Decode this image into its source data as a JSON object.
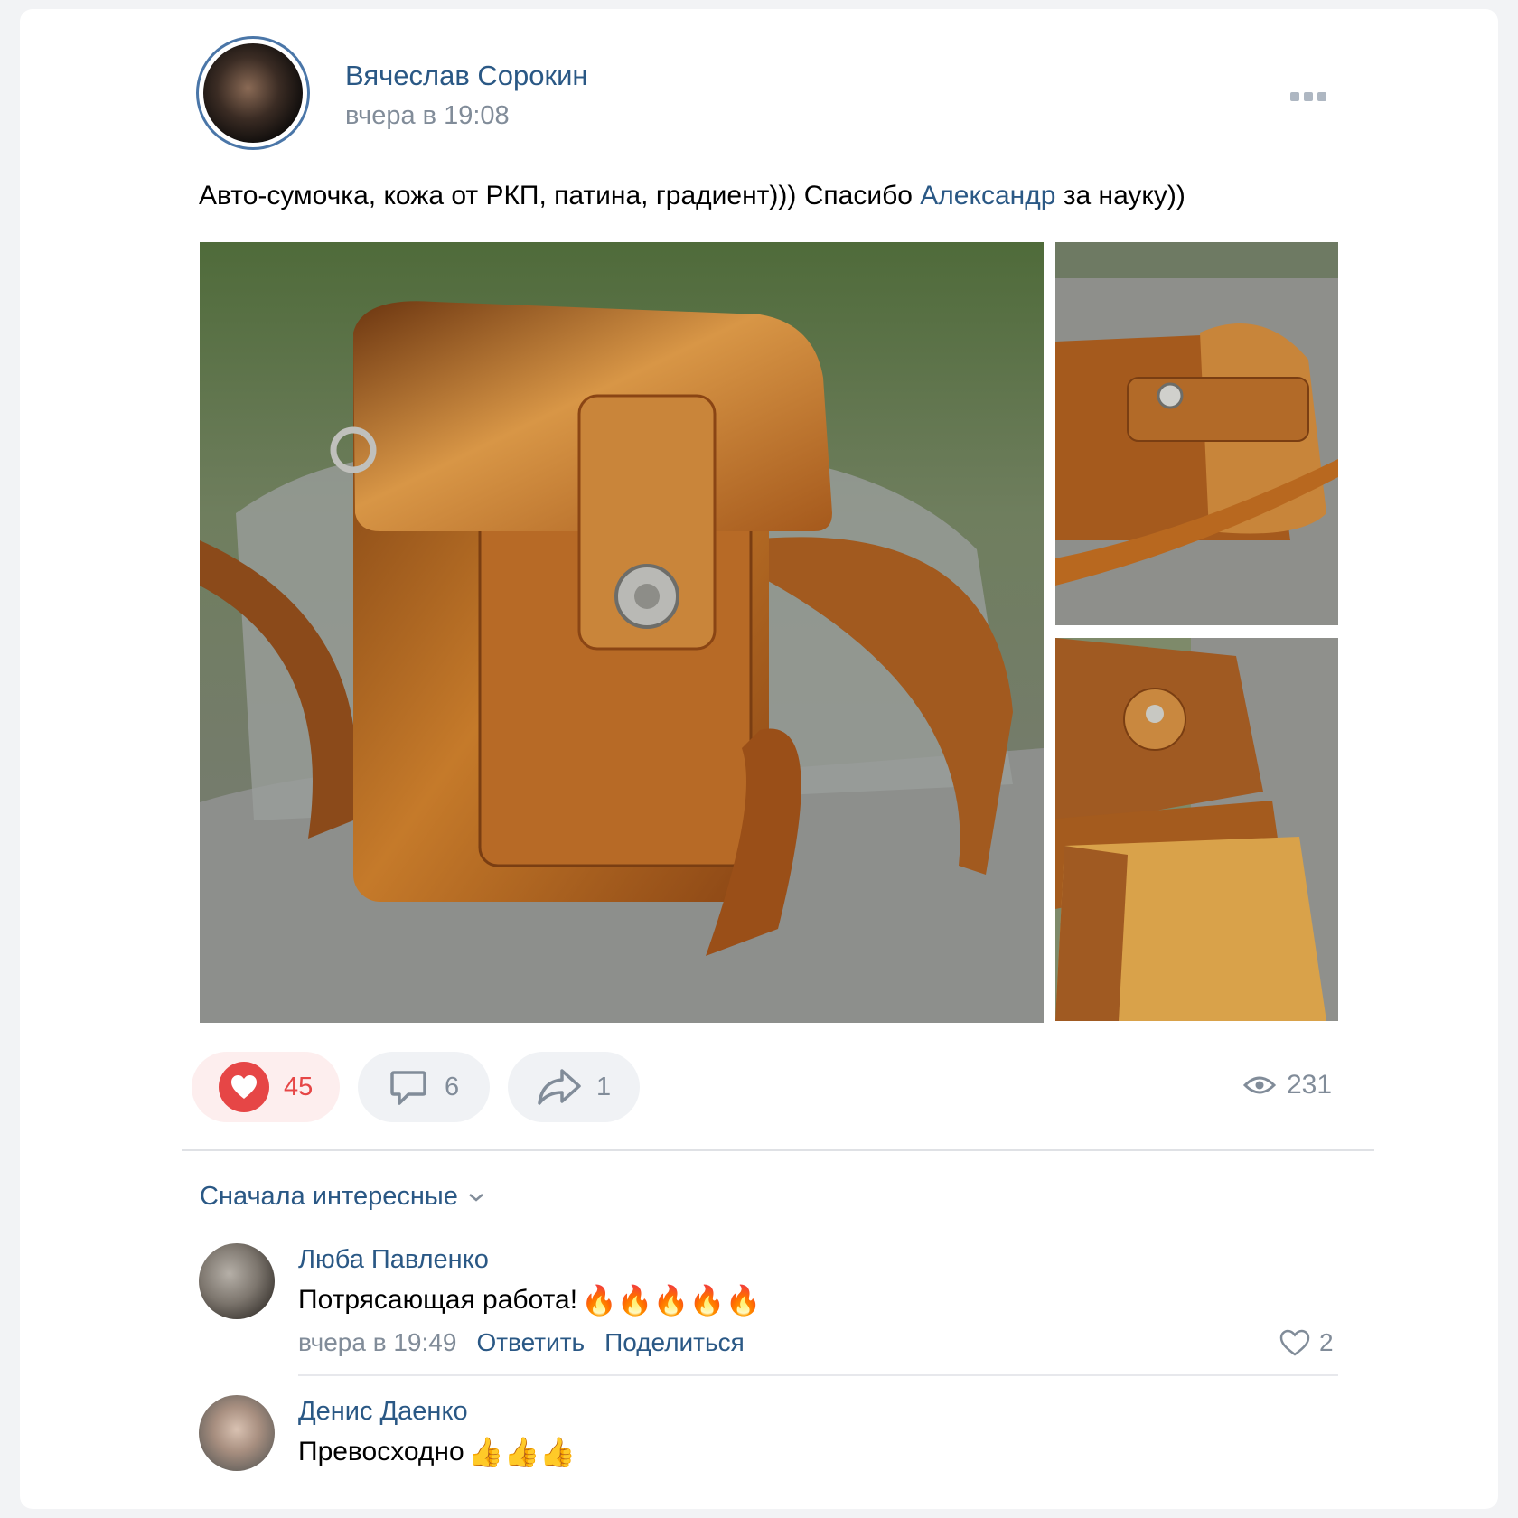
{
  "post": {
    "author": "Вячеслав Сорокин",
    "time": "вчера в 19:08",
    "text_before": "Авто-сумочка, кожа от РКП, патина, градиент))) Спасибо ",
    "mention": "Александр",
    "text_after": " за науку))",
    "photos": [
      "leather-bag-front",
      "leather-bag-side",
      "leather-bag-open"
    ]
  },
  "actions": {
    "likes": "45",
    "comments": "6",
    "shares": "1",
    "views": "231"
  },
  "comments": {
    "sort_label": "Сначала интересные",
    "items": [
      {
        "author": "Люба Павленко",
        "text": "Потрясающая работа!",
        "emoji": "🔥🔥🔥🔥🔥",
        "time": "вчера в 19:49",
        "reply_label": "Ответить",
        "share_label": "Поделиться",
        "likes": "2"
      },
      {
        "author": "Денис Даенко",
        "text": "Превосходно",
        "emoji": "👍👍👍"
      }
    ]
  },
  "colors": {
    "link": "#2a5885",
    "secondary": "#818c99",
    "like_red": "#e64646"
  }
}
